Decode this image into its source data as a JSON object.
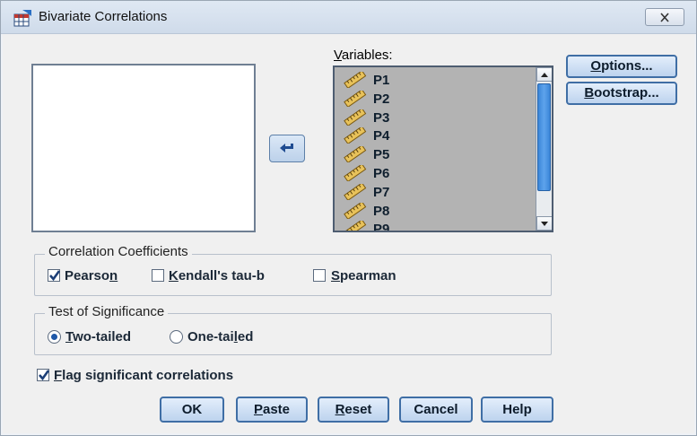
{
  "window": {
    "title": "Bivariate Correlations"
  },
  "variables": {
    "label": "Variables:",
    "items": [
      "P1",
      "P2",
      "P3",
      "P4",
      "P5",
      "P6",
      "P7",
      "P8",
      "P9"
    ]
  },
  "side_buttons": {
    "options": "Options...",
    "bootstrap": "Bootstrap..."
  },
  "coefficients": {
    "legend": "Correlation Coefficients",
    "pearson": {
      "label": "Pearson",
      "checked": true
    },
    "kendall": {
      "label": "Kendall's tau-b",
      "checked": false
    },
    "spearman": {
      "label": "Spearman",
      "checked": false
    }
  },
  "significance": {
    "legend": "Test of Significance",
    "two_tailed": {
      "label": "Two-tailed",
      "selected": true
    },
    "one_tailed": {
      "label": "One-tailed",
      "selected": false
    }
  },
  "flag": {
    "label": "Flag significant correlations",
    "checked": true
  },
  "buttons": {
    "ok": "OK",
    "paste": "Paste",
    "reset": "Reset",
    "cancel": "Cancel",
    "help": "Help"
  },
  "colors": {
    "accent": "#3f6ea5",
    "list_bg": "#b3b3b3",
    "scroll_thumb": "#3b86d8"
  }
}
